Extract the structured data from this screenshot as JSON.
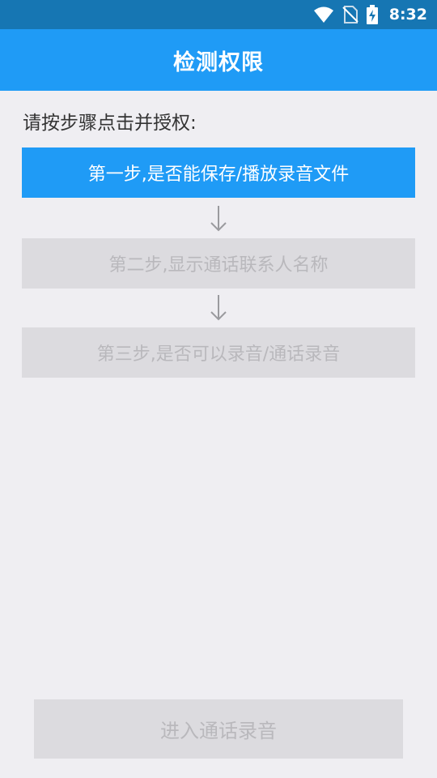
{
  "status_bar": {
    "time": "8:32",
    "icons": [
      "wifi-icon",
      "no-sim-icon",
      "battery-charging-icon"
    ]
  },
  "app_bar": {
    "title": "检测权限"
  },
  "instruction": "请按步骤点击并授权:",
  "steps": [
    {
      "label": "第一步,是否能保存/播放录音文件",
      "state": "active"
    },
    {
      "label": "第二步,显示通话联系人名称",
      "state": "disabled"
    },
    {
      "label": "第三步,是否可以录音/通话录音",
      "state": "disabled"
    }
  ],
  "step_arrow_icon": "arrow-down-icon",
  "enter_button": {
    "label": "进入通话录音",
    "state": "disabled"
  },
  "colors": {
    "status_bar": "#1676b3",
    "app_bar": "#1f9bf6",
    "active_step": "#1f9bf6",
    "disabled_bg": "#dcdbdf",
    "disabled_text": "#b9b8bc",
    "background": "#efeef2"
  }
}
